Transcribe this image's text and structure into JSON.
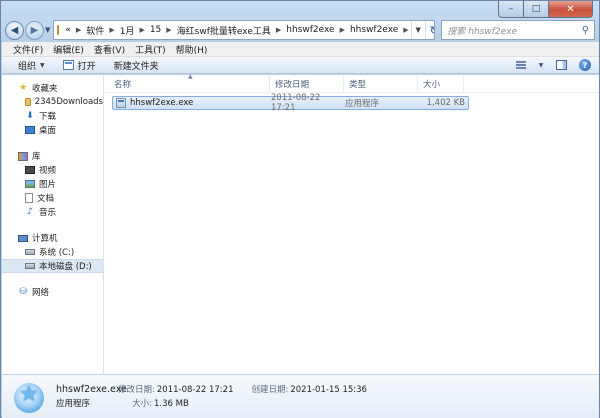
{
  "window": {
    "caption": {
      "minimize": "–",
      "maximize": "□",
      "close": "✕"
    }
  },
  "address": {
    "lead_icon": "folder-icon",
    "prefix": "«",
    "crumbs": [
      "软件",
      "1月",
      "15",
      "海红swf批量转exe工具",
      "hhswf2exe",
      "hhswf2exe"
    ],
    "search_placeholder": "搜索 hhswf2exe"
  },
  "menu": [
    "文件(F)",
    "编辑(E)",
    "查看(V)",
    "工具(T)",
    "帮助(H)"
  ],
  "toolbar": {
    "organize": "组织",
    "open": "打开",
    "new_folder": "新建文件夹"
  },
  "nav": {
    "favorites": {
      "label": "收藏夹",
      "items": [
        "2345Downloads",
        "下载",
        "桌面"
      ]
    },
    "libraries": {
      "label": "库",
      "items": [
        "视频",
        "图片",
        "文档",
        "音乐"
      ]
    },
    "computer": {
      "label": "计算机",
      "items": [
        "系统 (C:)",
        "本地磁盘 (D:)"
      ]
    },
    "network": {
      "label": "网络"
    }
  },
  "columns": {
    "name": "名称",
    "date": "修改日期",
    "type": "类型",
    "size": "大小"
  },
  "files": [
    {
      "name": "hhswf2exe.exe",
      "date": "2011-08-22 17:21",
      "type": "应用程序",
      "size": "1,402 KB"
    }
  ],
  "details": {
    "name": "hhswf2exe.exe",
    "type": "应用程序",
    "modified_label": "修改日期:",
    "modified_value": "2011-08-22 17:21",
    "created_label": "创建日期:",
    "created_value": "2021-01-15 15:36",
    "size_label": "大小:",
    "size_value": "1.36 MB"
  }
}
